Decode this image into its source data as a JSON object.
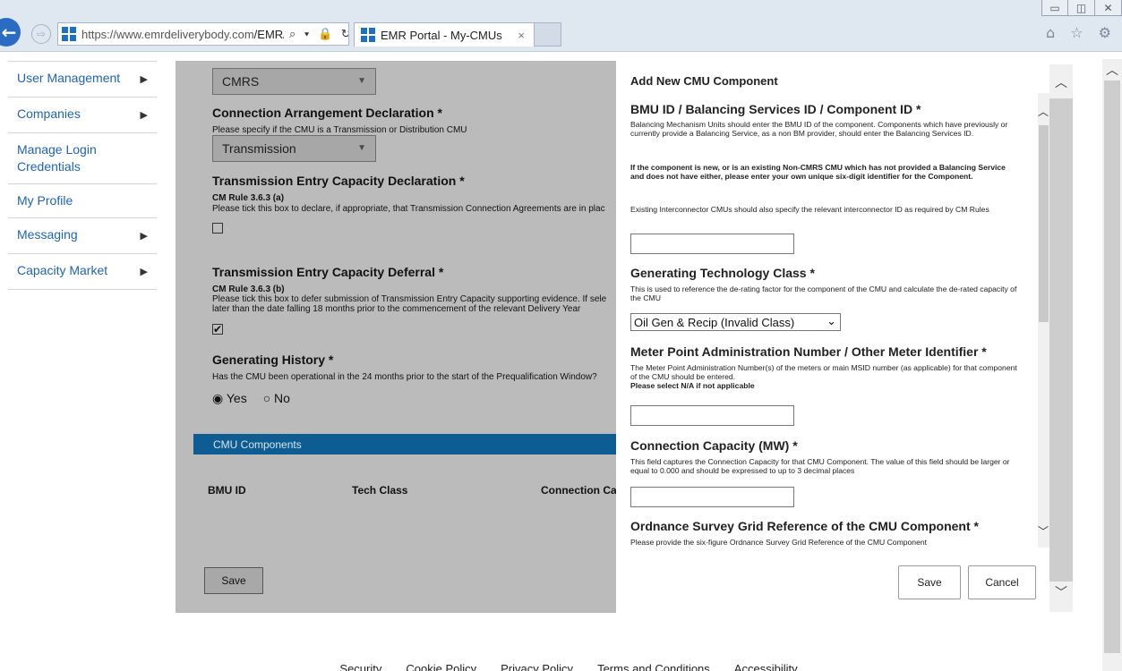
{
  "browser": {
    "url_host": "https://www.emrdeliverybody.com",
    "url_path": "/EMR/N",
    "tab_title": "EMR Portal - My-CMUs",
    "tab_close": "×",
    "win_min": "▭",
    "win_max": "◫",
    "win_close": "✕",
    "back": "←",
    "forward": "⇨",
    "url_icons": "⌕ ▾ 🔒 ↻",
    "tool_icons": "⌂ ☆ ⚙"
  },
  "sidebar": {
    "items": [
      {
        "label": "User Management",
        "arrow": "▶"
      },
      {
        "label": "Companies",
        "arrow": "▶"
      },
      {
        "label": "Manage Login Credentials",
        "arrow": ""
      },
      {
        "label": "My Profile",
        "arrow": ""
      },
      {
        "label": "Messaging",
        "arrow": "▶"
      },
      {
        "label": "Capacity Market",
        "arrow": "▶"
      }
    ]
  },
  "main": {
    "top_select": "CMRS",
    "caret": "▼",
    "connection": {
      "title": "Connection Arrangement Declaration *",
      "help": "Please specify if the CMU is a Transmission or Distribution CMU",
      "value": "Transmission"
    },
    "tec_decl": {
      "title": "Transmission Entry Capacity Declaration *",
      "rule": "CM Rule 3.6.3 (a)",
      "help": "Please tick this box to declare, if appropriate, that Transmission Connection Agreements are in plac",
      "checked": ""
    },
    "tec_defer": {
      "title": "Transmission Entry Capacity Deferral *",
      "rule": "CM Rule 3.6.3 (b)",
      "help1": "Please tick this box to defer submission of Transmission Entry Capacity supporting evidence. If sele",
      "help2": "later than the date falling 18 months prior to the commencement of the relevant Delivery Year",
      "checked": "✔"
    },
    "gen_history": {
      "title": "Generating History *",
      "help": "Has the CMU been operational in the 24 months prior to the start of the Prequalification Window?",
      "yes": "◉ Yes",
      "no": "○ No"
    },
    "components_bar": "CMU Components",
    "columns": [
      "BMU ID",
      "Tech Class",
      "Connection Ca"
    ],
    "save": "Save"
  },
  "modal": {
    "title": "Add New CMU Component",
    "bmu": {
      "title": "BMU ID / Balancing Services ID / Component ID *",
      "p1": "Balancing Mechanism Units should enter the BMU ID of the component. Components which have previously or currently provide a Balancing Service, as a non BM provider, should enter the Balancing Services ID.",
      "p2": "If the component is new, or is an existing Non-CMRS CMU which has not provided a Balancing Service and does not have either, please enter your own unique six-digit identifier for the Component.",
      "p3": "Existing Interconnector CMUs should also specify the relevant interconnector ID as required by CM Rules",
      "value": ""
    },
    "gen_tech": {
      "title": "Generating Technology Class *",
      "help": "This is used to reference the de-rating factor for the component of the CMU and calculate the de-rated capacity of the CMU",
      "value": "Oil Gen & Recip (Invalid Class)",
      "chev": "⌄"
    },
    "mpan": {
      "title": "Meter Point Administration Number / Other Meter Identifier *",
      "help": "The Meter Point Administration Number(s) of the meters or main MSID number (as applicable) for that component of the CMU should be entered.",
      "note": "Please select N/A if not applicable",
      "value": ""
    },
    "conn_cap": {
      "title": "Connection Capacity (MW) *",
      "help": "This field captures the Connection Capacity for that CMU Component. The value of this field should be larger or equal to 0.000 and should be expressed to up to 3 decimal places",
      "value": ""
    },
    "grid_ref": {
      "title": "Ordnance Survey Grid Reference of the CMU Component *",
      "help": "Please provide the six-figure Ordnance Survey Grid Reference of the CMU Component"
    },
    "save": "Save",
    "cancel": "Cancel",
    "scroll_up": "︿",
    "scroll_down": "﹀"
  },
  "footer": {
    "links": [
      "Security",
      "Cookie Policy",
      "Privacy Policy",
      "Terms and Conditions",
      "Accessibility"
    ]
  },
  "colors": {
    "link": "#1f63b6",
    "components_bar": "#0e5d92",
    "overlay": "#8a8a8a"
  }
}
